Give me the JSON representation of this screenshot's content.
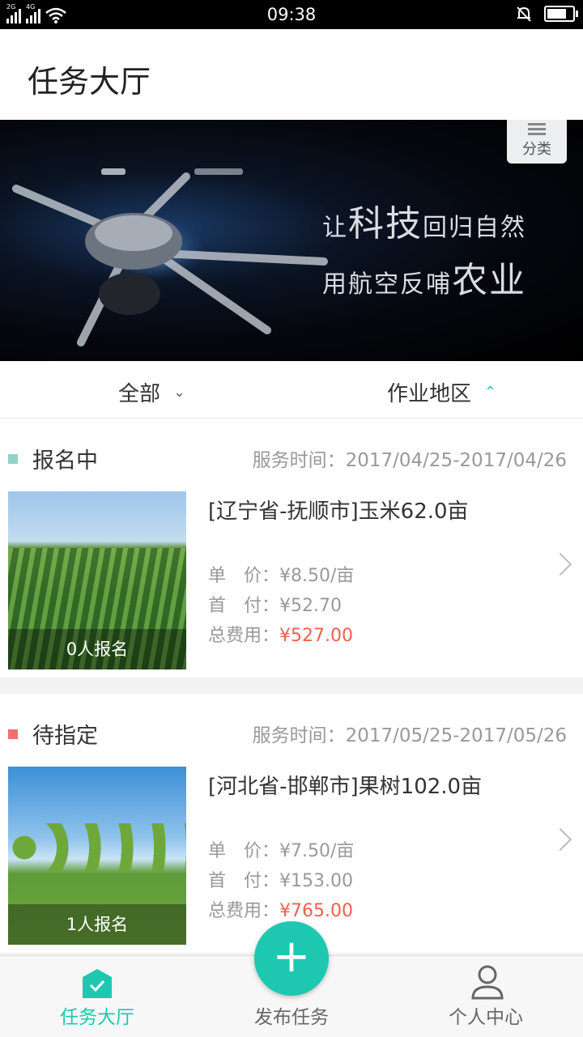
{
  "status_bar": {
    "time": "09:38",
    "net1": "2G",
    "net2": "4G",
    "battery_level": 0.9
  },
  "header": {
    "title": "任务大厅"
  },
  "banner": {
    "line1_a": "让",
    "line1_b": "科技",
    "line1_c": "回归自然",
    "line2_a": "用航空反哺",
    "line2_b": "农业",
    "category_label": "分类"
  },
  "filters": {
    "all": "全部",
    "region": "作业地区"
  },
  "tasks": [
    {
      "status": "报名中",
      "status_color": "#8fd3c9",
      "time_label": "服务时间：",
      "time": "2017/04/25-2017/04/26",
      "title": "[辽宁省-抚顺市]玉米62.0亩",
      "unit_label": "单　价：",
      "unit": "¥8.50/亩",
      "down_label": "首　付：",
      "down": "¥52.70",
      "total_label": "总费用：",
      "total": "¥527.00",
      "count": "0人报名"
    },
    {
      "status": "待指定",
      "status_color": "#f07070",
      "time_label": "服务时间：",
      "time": "2017/05/25-2017/05/26",
      "title": "[河北省-邯郸市]果树102.0亩",
      "unit_label": "单　价：",
      "unit": "¥7.50/亩",
      "down_label": "首　付：",
      "down": "¥153.00",
      "total_label": "总费用：",
      "total": "¥765.00",
      "count": "1人报名"
    }
  ],
  "tabbar": {
    "hall": "任务大厅",
    "publish": "发布任务",
    "me": "个人中心",
    "fab": "+"
  },
  "colors": {
    "accent": "#1ec8b0",
    "price_red": "#f0604f"
  }
}
